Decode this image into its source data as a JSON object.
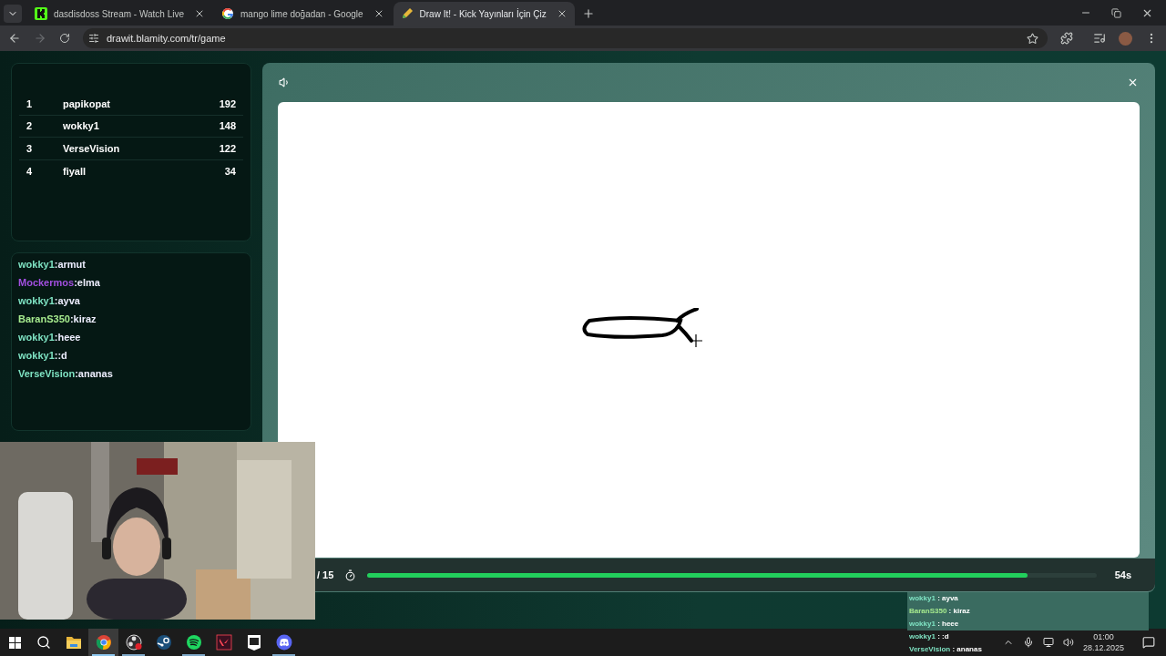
{
  "browser": {
    "tabs": [
      {
        "title": "dasdisdoss Stream - Watch Live",
        "kind": "kick",
        "selected": false
      },
      {
        "title": "mango lime doğadan - Google",
        "kind": "google",
        "selected": false
      },
      {
        "title": "Draw It! - Kick Yayınları İçin Çiz",
        "kind": "drawit",
        "selected": true
      }
    ],
    "url": "drawit.blamity.com/tr/game"
  },
  "scoreboard": [
    {
      "rank": "1",
      "name": "papikopat",
      "score": "192"
    },
    {
      "rank": "2",
      "name": "wokky1",
      "score": "148"
    },
    {
      "rank": "3",
      "name": "VerseVision",
      "score": "122"
    },
    {
      "rank": "4",
      "name": "fiyall",
      "score": "34"
    }
  ],
  "chat": [
    {
      "user": "wokky1",
      "text": ":armut",
      "color": "#7fe3c3"
    },
    {
      "user": "Mockermos",
      "text": ":elma",
      "color": "#a24fe0"
    },
    {
      "user": "wokky1",
      "text": ":ayva",
      "color": "#7fe3c3"
    },
    {
      "user": "BaranS350",
      "text": ":kiraz",
      "color": "#a6ea8e"
    },
    {
      "user": "wokky1",
      "text": ":heee",
      "color": "#7fe3c3"
    },
    {
      "user": "wokky1",
      "text": "::d",
      "color": "#7fe3c3"
    },
    {
      "user": "VerseVision",
      "text": ":ananas",
      "color": "#7fe3c3"
    }
  ],
  "game": {
    "round": "/ 15",
    "timer": {
      "level": 0.905,
      "reading": "54s"
    }
  },
  "stream_overlay": {
    "chat": [
      {
        "user": "wokky1",
        "text": " : ayva",
        "color": "#7fe3c3"
      },
      {
        "user": "BaranS350",
        "text": " : kiraz",
        "color": "#a6ea8e"
      },
      {
        "user": "wokky1",
        "text": " : heee",
        "color": "#7fe3c3"
      },
      {
        "user": "wokky1",
        "text": " : :d",
        "color": "#7fe3c3"
      },
      {
        "user": "VerseVision",
        "text": " : ananas",
        "color": "#7fe3c3"
      }
    ]
  },
  "taskbar": {
    "apps": [
      {
        "kind": "explorer",
        "running": false,
        "active": false
      },
      {
        "kind": "chrome",
        "running": true,
        "active": true
      },
      {
        "kind": "obs",
        "running": true,
        "active": false
      },
      {
        "kind": "steam",
        "running": false,
        "active": false
      },
      {
        "kind": "spotify",
        "running": true,
        "active": false
      },
      {
        "kind": "valorant",
        "running": false,
        "active": false
      },
      {
        "kind": "epic",
        "running": false,
        "active": false
      },
      {
        "kind": "discord",
        "running": true,
        "active": false
      }
    ],
    "time": "01:00",
    "date": "28.12.2025"
  }
}
